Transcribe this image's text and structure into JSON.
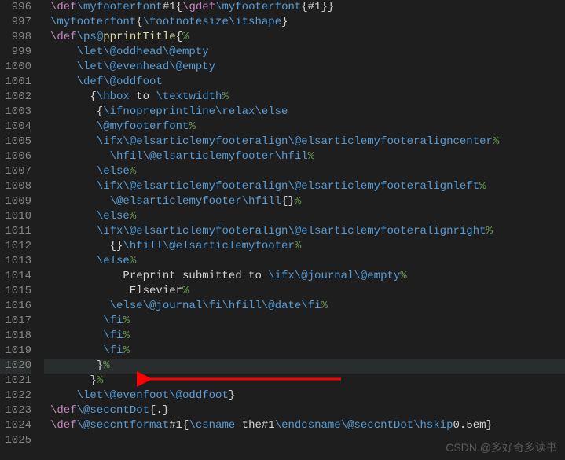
{
  "watermark": "CSDN @多好奇多读书",
  "lines": [
    {
      "num": "996",
      "tokens": [
        {
          "t": "\\def",
          "c": "c-macro"
        },
        {
          "t": "\\myfooterfont",
          "c": "c-cmd"
        },
        {
          "t": "#1{",
          "c": "c-text"
        },
        {
          "t": "\\gdef",
          "c": "c-macro"
        },
        {
          "t": "\\myfooterfont",
          "c": "c-cmd"
        },
        {
          "t": "{#1}}",
          "c": "c-text"
        }
      ]
    },
    {
      "num": "997",
      "tokens": [
        {
          "t": "\\myfooterfont",
          "c": "c-cmd"
        },
        {
          "t": "{",
          "c": "c-brace"
        },
        {
          "t": "\\footnotesize\\itshape",
          "c": "c-cmd"
        },
        {
          "t": "}",
          "c": "c-brace"
        }
      ]
    },
    {
      "num": "998",
      "tokens": [
        {
          "t": "\\def",
          "c": "c-macro"
        },
        {
          "t": "\\ps@",
          "c": "c-cmd"
        },
        {
          "t": "pprintTitle",
          "c": "c-func"
        },
        {
          "t": "{",
          "c": "c-brace"
        },
        {
          "t": "%",
          "c": "c-comment"
        }
      ]
    },
    {
      "num": "999",
      "tokens": [
        {
          "t": "    ",
          "c": "c-text"
        },
        {
          "t": "\\let\\@oddhead\\@empty",
          "c": "c-cmd"
        }
      ]
    },
    {
      "num": "1000",
      "tokens": [
        {
          "t": "    ",
          "c": "c-text"
        },
        {
          "t": "\\let\\@evenhead\\@empty",
          "c": "c-cmd"
        }
      ]
    },
    {
      "num": "1001",
      "tokens": [
        {
          "t": "    ",
          "c": "c-text"
        },
        {
          "t": "\\def\\@oddfoot",
          "c": "c-cmd"
        }
      ]
    },
    {
      "num": "1002",
      "tokens": [
        {
          "t": "      {",
          "c": "c-text"
        },
        {
          "t": "\\hbox",
          "c": "c-cmd"
        },
        {
          "t": " to ",
          "c": "c-text"
        },
        {
          "t": "\\textwidth",
          "c": "c-cmd"
        },
        {
          "t": "%",
          "c": "c-comment"
        }
      ]
    },
    {
      "num": "1003",
      "tokens": [
        {
          "t": "       {",
          "c": "c-text"
        },
        {
          "t": "\\ifnopreprintline\\relax\\else",
          "c": "c-cmd"
        }
      ]
    },
    {
      "num": "1004",
      "tokens": [
        {
          "t": "       ",
          "c": "c-text"
        },
        {
          "t": "\\@myfooterfont",
          "c": "c-cmd"
        },
        {
          "t": "%",
          "c": "c-comment"
        }
      ]
    },
    {
      "num": "1005",
      "tokens": [
        {
          "t": "       ",
          "c": "c-text"
        },
        {
          "t": "\\ifx\\@elsarticlemyfooteralign\\@elsarticlemyfooteraligncenter",
          "c": "c-cmd"
        },
        {
          "t": "%",
          "c": "c-comment"
        }
      ]
    },
    {
      "num": "1006",
      "tokens": [
        {
          "t": "         ",
          "c": "c-text"
        },
        {
          "t": "\\hfil\\@elsarticlemyfooter\\hfil",
          "c": "c-cmd"
        },
        {
          "t": "%",
          "c": "c-comment"
        }
      ]
    },
    {
      "num": "1007",
      "tokens": [
        {
          "t": "       ",
          "c": "c-text"
        },
        {
          "t": "\\else",
          "c": "c-cmd"
        },
        {
          "t": "%",
          "c": "c-comment"
        }
      ]
    },
    {
      "num": "1008",
      "tokens": [
        {
          "t": "       ",
          "c": "c-text"
        },
        {
          "t": "\\ifx\\@elsarticlemyfooteralign\\@elsarticlemyfooteralignleft",
          "c": "c-cmd"
        },
        {
          "t": "%",
          "c": "c-comment"
        }
      ]
    },
    {
      "num": "1009",
      "tokens": [
        {
          "t": "         ",
          "c": "c-text"
        },
        {
          "t": "\\@elsarticlemyfooter\\hfill",
          "c": "c-cmd"
        },
        {
          "t": "{}",
          "c": "c-text"
        },
        {
          "t": "%",
          "c": "c-comment"
        }
      ]
    },
    {
      "num": "1010",
      "tokens": [
        {
          "t": "       ",
          "c": "c-text"
        },
        {
          "t": "\\else",
          "c": "c-cmd"
        },
        {
          "t": "%",
          "c": "c-comment"
        }
      ]
    },
    {
      "num": "1011",
      "tokens": [
        {
          "t": "       ",
          "c": "c-text"
        },
        {
          "t": "\\ifx\\@elsarticlemyfooteralign\\@elsarticlemyfooteralignright",
          "c": "c-cmd"
        },
        {
          "t": "%",
          "c": "c-comment"
        }
      ]
    },
    {
      "num": "1012",
      "tokens": [
        {
          "t": "         {}",
          "c": "c-text"
        },
        {
          "t": "\\hfill\\@elsarticlemyfooter",
          "c": "c-cmd"
        },
        {
          "t": "%",
          "c": "c-comment"
        }
      ]
    },
    {
      "num": "1013",
      "tokens": [
        {
          "t": "       ",
          "c": "c-text"
        },
        {
          "t": "\\else",
          "c": "c-cmd"
        },
        {
          "t": "%",
          "c": "c-comment"
        }
      ]
    },
    {
      "num": "1014",
      "tokens": [
        {
          "t": "           Preprint submitted to ",
          "c": "c-text"
        },
        {
          "t": "\\ifx\\@journal\\@empty",
          "c": "c-cmd"
        },
        {
          "t": "%",
          "c": "c-comment"
        }
      ]
    },
    {
      "num": "1015",
      "tokens": [
        {
          "t": "            Elsevier",
          "c": "c-text"
        },
        {
          "t": "%",
          "c": "c-comment"
        }
      ]
    },
    {
      "num": "1016",
      "tokens": [
        {
          "t": "         ",
          "c": "c-text"
        },
        {
          "t": "\\else\\@journal\\fi\\hfill\\@date\\fi",
          "c": "c-cmd"
        },
        {
          "t": "%",
          "c": "c-comment"
        }
      ]
    },
    {
      "num": "1017",
      "tokens": [
        {
          "t": "        ",
          "c": "c-text"
        },
        {
          "t": "\\fi",
          "c": "c-cmd"
        },
        {
          "t": "%",
          "c": "c-comment"
        }
      ]
    },
    {
      "num": "1018",
      "tokens": [
        {
          "t": "        ",
          "c": "c-text"
        },
        {
          "t": "\\fi",
          "c": "c-cmd"
        },
        {
          "t": "%",
          "c": "c-comment"
        }
      ]
    },
    {
      "num": "1019",
      "tokens": [
        {
          "t": "        ",
          "c": "c-text"
        },
        {
          "t": "\\fi",
          "c": "c-cmd"
        },
        {
          "t": "%",
          "c": "c-comment"
        }
      ]
    },
    {
      "num": "1020",
      "hl": true,
      "tokens": [
        {
          "t": "       }",
          "c": "c-text"
        },
        {
          "t": "%",
          "c": "c-comment"
        }
      ]
    },
    {
      "num": "1021",
      "tokens": [
        {
          "t": "      }",
          "c": "c-text"
        },
        {
          "t": "%",
          "c": "c-comment"
        }
      ]
    },
    {
      "num": "1022",
      "tokens": [
        {
          "t": "    ",
          "c": "c-text"
        },
        {
          "t": "\\let\\@evenfoot\\@oddfoot",
          "c": "c-cmd"
        },
        {
          "t": "}",
          "c": "c-brace"
        }
      ]
    },
    {
      "num": "1023",
      "tokens": [
        {
          "t": "\\def",
          "c": "c-macro"
        },
        {
          "t": "\\@seccntDot",
          "c": "c-cmd"
        },
        {
          "t": "{.}",
          "c": "c-text"
        }
      ]
    },
    {
      "num": "1024",
      "tokens": [
        {
          "t": "\\def",
          "c": "c-macro"
        },
        {
          "t": "\\@seccntformat",
          "c": "c-cmd"
        },
        {
          "t": "#1{",
          "c": "c-text"
        },
        {
          "t": "\\csname",
          "c": "c-cmd"
        },
        {
          "t": " the#1",
          "c": "c-text"
        },
        {
          "t": "\\endcsname\\@seccntDot\\hskip",
          "c": "c-cmd"
        },
        {
          "t": "0.5em}",
          "c": "c-text"
        }
      ]
    },
    {
      "num": "1025",
      "tokens": []
    }
  ]
}
